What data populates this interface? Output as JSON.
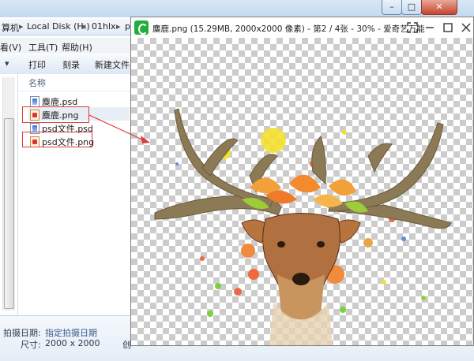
{
  "explorer": {
    "address": {
      "crumb_computer": "算机",
      "crumb_disk": "Local Disk (H:)",
      "crumb_folder": "01hlx",
      "crumb_more": "p"
    },
    "menu": {
      "view": "看(V)",
      "tools": "工具(T)",
      "help": "帮助(H)"
    },
    "toolbar": {
      "print": "打印",
      "burn": "刻录",
      "new_folder": "新建文件夹"
    },
    "column_header": "名称",
    "files": [
      {
        "name": "麋鹿.psd",
        "type": "psd"
      },
      {
        "name": "麋鹿.png",
        "type": "png"
      },
      {
        "name": "psd文件.psd",
        "type": "psd"
      },
      {
        "name": "psd文件.png",
        "type": "png"
      }
    ],
    "details": {
      "date_label": "拍摄日期:",
      "date_value": "指定拍摄日期",
      "size_label": "尺寸:",
      "size_value": "2000 x 2000",
      "created_partial": "创"
    }
  },
  "viewer": {
    "title": "麋鹿.png (15.29MB, 2000x2000 像素) - 第2 / 4张 - 30% - 爱奇艺万能",
    "icons": [
      "fullscreen-icon",
      "minimize-icon",
      "maximize-icon",
      "close-icon"
    ]
  },
  "colors": {
    "annotation": "#e03a3a",
    "viewer_logo": "#1fae3e",
    "checker": "#cccccc"
  }
}
